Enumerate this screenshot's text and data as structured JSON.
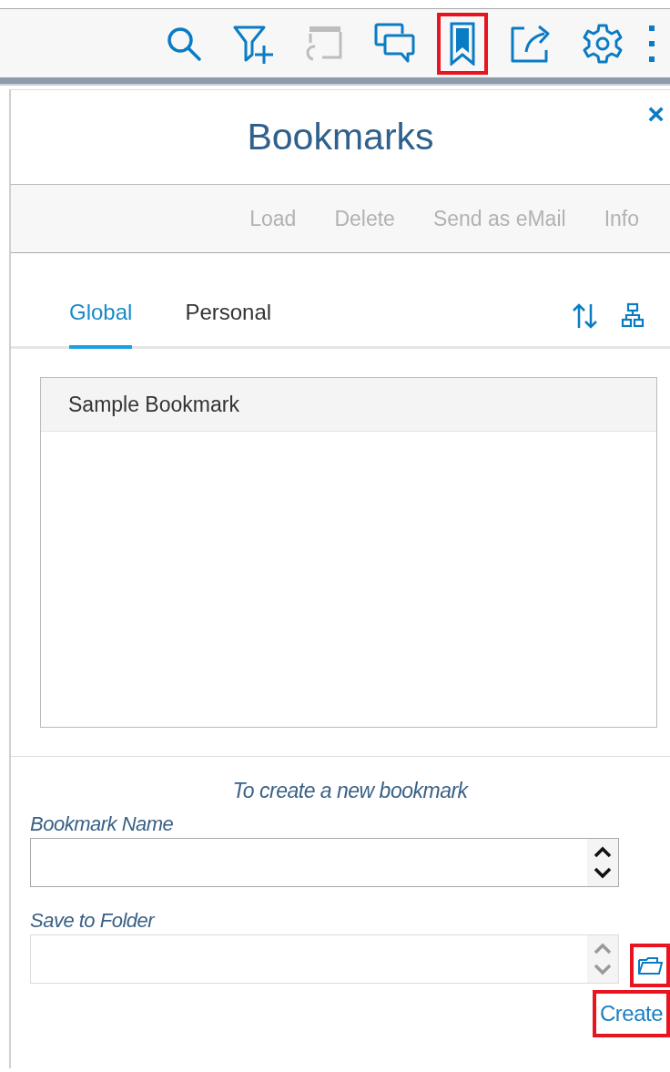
{
  "toolbar": {
    "items": [
      {
        "kind": "search",
        "disabled": false,
        "highlighted": false
      },
      {
        "kind": "filter-add",
        "disabled": false,
        "highlighted": false
      },
      {
        "kind": "window-restore",
        "disabled": true,
        "highlighted": false
      },
      {
        "kind": "comments",
        "disabled": false,
        "highlighted": false
      },
      {
        "kind": "bookmark",
        "disabled": false,
        "highlighted": true
      },
      {
        "kind": "share",
        "disabled": false,
        "highlighted": false
      },
      {
        "kind": "settings",
        "disabled": false,
        "highlighted": false
      },
      {
        "kind": "more",
        "disabled": false,
        "highlighted": false
      }
    ]
  },
  "panel": {
    "title": "Bookmarks",
    "close": "×",
    "actions": [
      {
        "label": "Load",
        "disabled": true
      },
      {
        "label": "Delete",
        "disabled": true
      },
      {
        "label": "Send as eMail",
        "disabled": true
      },
      {
        "label": "Info",
        "disabled": true
      }
    ],
    "tabs": [
      {
        "label": "Global",
        "selected": true
      },
      {
        "label": "Personal",
        "selected": false
      }
    ],
    "list": {
      "items": [
        {
          "label": "Sample Bookmark",
          "selected": false
        }
      ]
    },
    "form": {
      "heading": "To create a new bookmark",
      "fields": [
        {
          "label": "Bookmark Name",
          "disabled": false
        },
        {
          "label": "Save to Folder",
          "disabled": true
        }
      ],
      "folder_button": {
        "highlighted": true
      },
      "create_button": {
        "label": "Create",
        "highlighted": true
      }
    }
  }
}
